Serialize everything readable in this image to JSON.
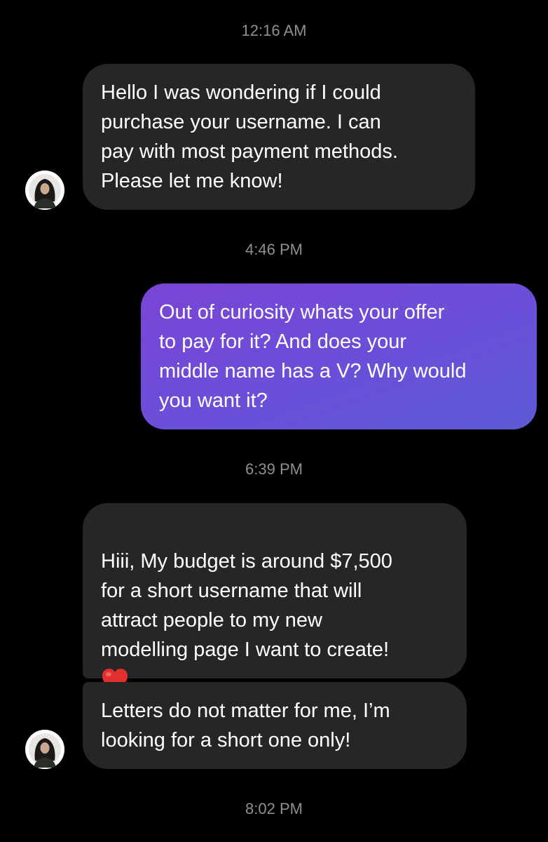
{
  "thread": {
    "timestamps": [
      "12:16 AM",
      "4:46 PM",
      "6:39 PM",
      "8:02 PM"
    ],
    "messages": [
      {
        "from": "them",
        "text": "Hello I was wondering if I could\npurchase your username. I can\npay with most payment methods.\nPlease let me know!"
      },
      {
        "from": "me",
        "text": "Out of curiosity whats your offer\nto pay for it? And does your\nmiddle name has a V? Why would\nyou want it?"
      },
      {
        "from": "them",
        "text": "Hiii, My budget is around $7,500\nfor a short username that will\nattract people to my new\nmodelling page I want to create!",
        "emoji": "red-heart"
      },
      {
        "from": "them",
        "text": "Letters do not matter for me, I’m\nlooking for a short one only!"
      }
    ]
  },
  "colors": {
    "background": "#000000",
    "incoming_bubble": "#262626",
    "outgoing_bubble_gradient": [
      "#7a45d6",
      "#5c5bd6"
    ],
    "timestamp_text": "#8e8e93",
    "heart": "#e0312f"
  },
  "icons": {
    "avatar": "sender-avatar",
    "emoji": "red-heart-icon"
  }
}
